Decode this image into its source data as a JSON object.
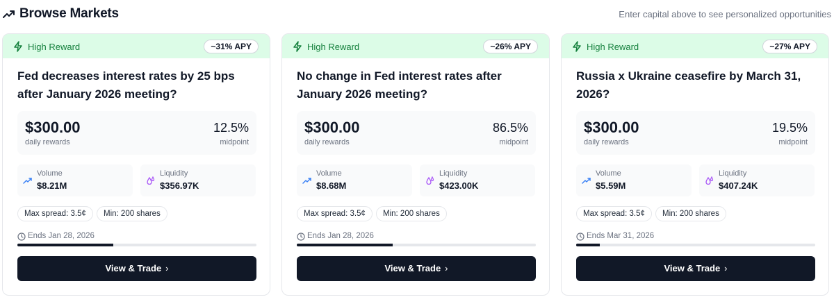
{
  "header": {
    "title": "Browse Markets",
    "subtitle": "Enter capital above to see personalized opportunities",
    "icon": "trending-up-icon"
  },
  "colors": {
    "reward_band": "#dcfce7",
    "reward_text": "#15803d",
    "cta_bg": "#111827",
    "volume_icon": "#3b82f6",
    "liquidity_icon": "#a855f7"
  },
  "cards": [
    {
      "badge": "High Reward",
      "apy": "~31% APY",
      "question": "Fed decreases interest rates by 25 bps after January 2026 meeting?",
      "reward_amount": "$300.00",
      "reward_label": "daily rewards",
      "midpoint": "12.5%",
      "midpoint_label": "midpoint",
      "volume_label": "Volume",
      "volume": "$8.21M",
      "liquidity_label": "Liquidity",
      "liquidity": "$356.97K",
      "max_spread": "Max spread: 3.5¢",
      "min_shares": "Min: 200 shares",
      "ends": "Ends Jan 28, 2026",
      "progress": 0.4,
      "cta": "View & Trade"
    },
    {
      "badge": "High Reward",
      "apy": "~26% APY",
      "question": "No change in Fed interest rates after January 2026 meeting?",
      "reward_amount": "$300.00",
      "reward_label": "daily rewards",
      "midpoint": "86.5%",
      "midpoint_label": "midpoint",
      "volume_label": "Volume",
      "volume": "$8.68M",
      "liquidity_label": "Liquidity",
      "liquidity": "$423.00K",
      "max_spread": "Max spread: 3.5¢",
      "min_shares": "Min: 200 shares",
      "ends": "Ends Jan 28, 2026",
      "progress": 0.4,
      "cta": "View & Trade"
    },
    {
      "badge": "High Reward",
      "apy": "~27% APY",
      "question": "Russia x Ukraine ceasefire by March 31, 2026?",
      "reward_amount": "$300.00",
      "reward_label": "daily rewards",
      "midpoint": "19.5%",
      "midpoint_label": "midpoint",
      "volume_label": "Volume",
      "volume": "$5.59M",
      "liquidity_label": "Liquidity",
      "liquidity": "$407.24K",
      "max_spread": "Max spread: 3.5¢",
      "min_shares": "Min: 200 shares",
      "ends": "Ends Mar 31, 2026",
      "progress": 0.1,
      "cta": "View & Trade"
    }
  ]
}
